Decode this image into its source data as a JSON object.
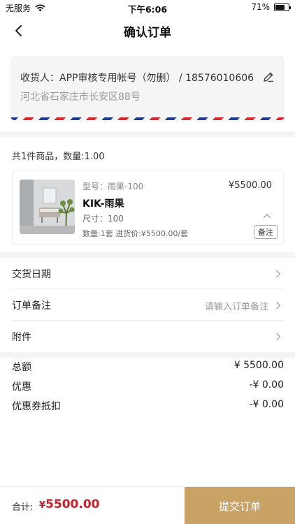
{
  "status_bar": {
    "carrier": "无服务",
    "time": "下午6:06",
    "battery_percent": "71%",
    "battery_level": 0.71
  },
  "nav": {
    "title": "确认订单"
  },
  "address": {
    "recipient_line": "收货人：APP审核专用帐号（勿删）  /  18576010606",
    "detail_line": "河北省石家庄市长安区88号"
  },
  "goods": {
    "summary": "共1件商品，数量:1.00",
    "product": {
      "model": "型号：雨果-100",
      "price": "¥5500.00",
      "name": "KIK-雨果",
      "size": "尺寸：100",
      "qty_line": "数量:1套 进货价:¥5500.00/套",
      "note_button": "备注"
    }
  },
  "rows": {
    "delivery_date": {
      "label": "交货日期"
    },
    "order_note": {
      "label": "订单备注",
      "placeholder": "请输入订单备注"
    },
    "attachment": {
      "label": "附件"
    }
  },
  "summary": {
    "total": {
      "label": "总额",
      "value": "¥ 5500.00"
    },
    "discount": {
      "label": "优惠",
      "value": "-¥ 0.00"
    },
    "coupon": {
      "label": "优惠券抵扣",
      "value": "-¥ 0.00"
    }
  },
  "bottom": {
    "total_label": "合计:",
    "currency": "¥",
    "total_amount": "5500.00",
    "submit_label": "提交订单"
  },
  "colors": {
    "accent_gold": "#c9a265",
    "price_red": "#c6212b",
    "airmail_red": "#d9262b",
    "airmail_blue": "#1f3c93"
  }
}
